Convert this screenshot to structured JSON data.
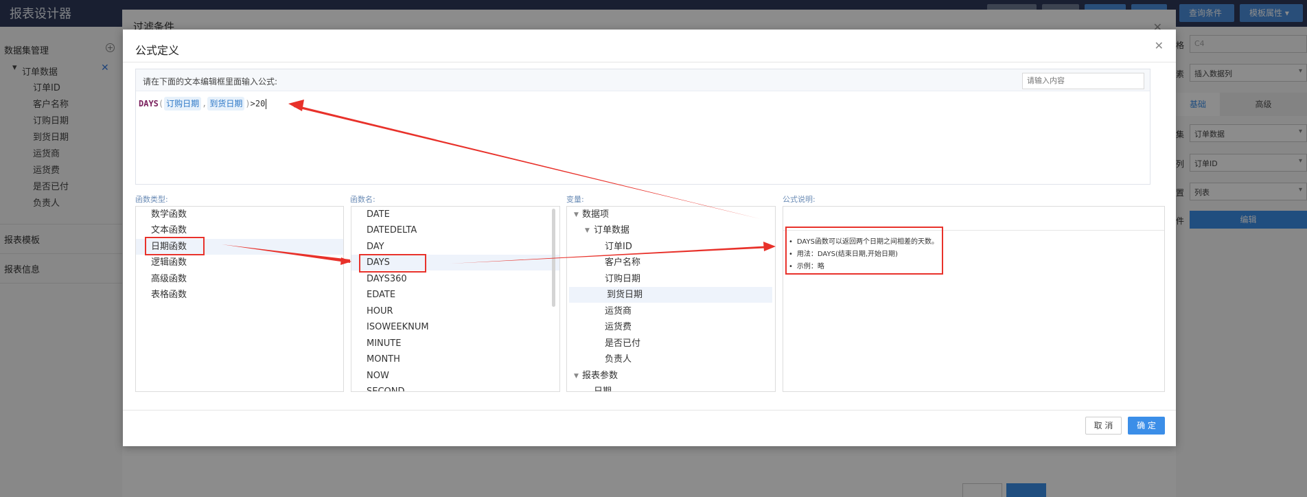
{
  "app": {
    "title": "报表设计器",
    "toolbar": {
      "btn1": "",
      "btn2": "",
      "btn3": "",
      "btn4": "",
      "query": "查询条件",
      "template_props": "模板属性"
    }
  },
  "left_panel": {
    "dataset_header": "数据集管理",
    "dataset": "订单数据",
    "fields": [
      "订单ID",
      "客户名称",
      "订购日期",
      "到货日期",
      "运货商",
      "运货费",
      "是否已付",
      "负责人"
    ],
    "template_header": "报表模板",
    "info_header": "报表信息"
  },
  "filter_dialog": {
    "title": "过滤条件"
  },
  "right_panel": {
    "labels": [
      "格",
      "素",
      "集",
      "列",
      "置",
      "件"
    ],
    "cell_value": "C4",
    "element_type": "插入数据列",
    "tab_basic": "基础",
    "tab_advanced": "高级",
    "dataset_value": "订单数据",
    "column_value": "订单ID",
    "layout_value": "列表",
    "edit_button": "编辑"
  },
  "dialog": {
    "title": "公式定义",
    "hint": "请在下面的文本编辑框里面输入公式:",
    "search_placeholder": "请输入内容",
    "formula": {
      "fn": "DAYS",
      "open": "(",
      "arg1": "订购日期",
      "sep": ",",
      "arg2": "到货日期",
      "close": ")",
      "rest": ">20"
    },
    "columns": {
      "types_label": "函数类型:",
      "names_label": "函数名:",
      "vars_label": "变量:",
      "desc_label": "公式说明:"
    },
    "function_types": [
      "数学函数",
      "文本函数",
      "日期函数",
      "逻辑函数",
      "高级函数",
      "表格函数"
    ],
    "function_names": [
      "DATE",
      "DATEDELTA",
      "DAY",
      "DAYS",
      "DAYS360",
      "EDATE",
      "HOUR",
      "ISOWEEKNUM",
      "MINUTE",
      "MONTH",
      "NOW",
      "SECOND"
    ],
    "variables": {
      "root": "数据项",
      "dataset": "订单数据",
      "fields": [
        "订单ID",
        "客户名称",
        "订购日期",
        "到货日期",
        "运货商",
        "运货费",
        "是否已付",
        "负责人"
      ],
      "params_root": "报表参数",
      "params": [
        "日期"
      ]
    },
    "description": [
      "DAYS函数可以返回两个日期之间相差的天数。",
      "用法：DAYS(结束日期,开始日期)",
      "示例：略"
    ],
    "cancel": "取 消",
    "ok": "确 定"
  },
  "colors": {
    "accent": "#3b8ee8",
    "annotation": "#e8312a",
    "topbar": "#2e3a59"
  }
}
